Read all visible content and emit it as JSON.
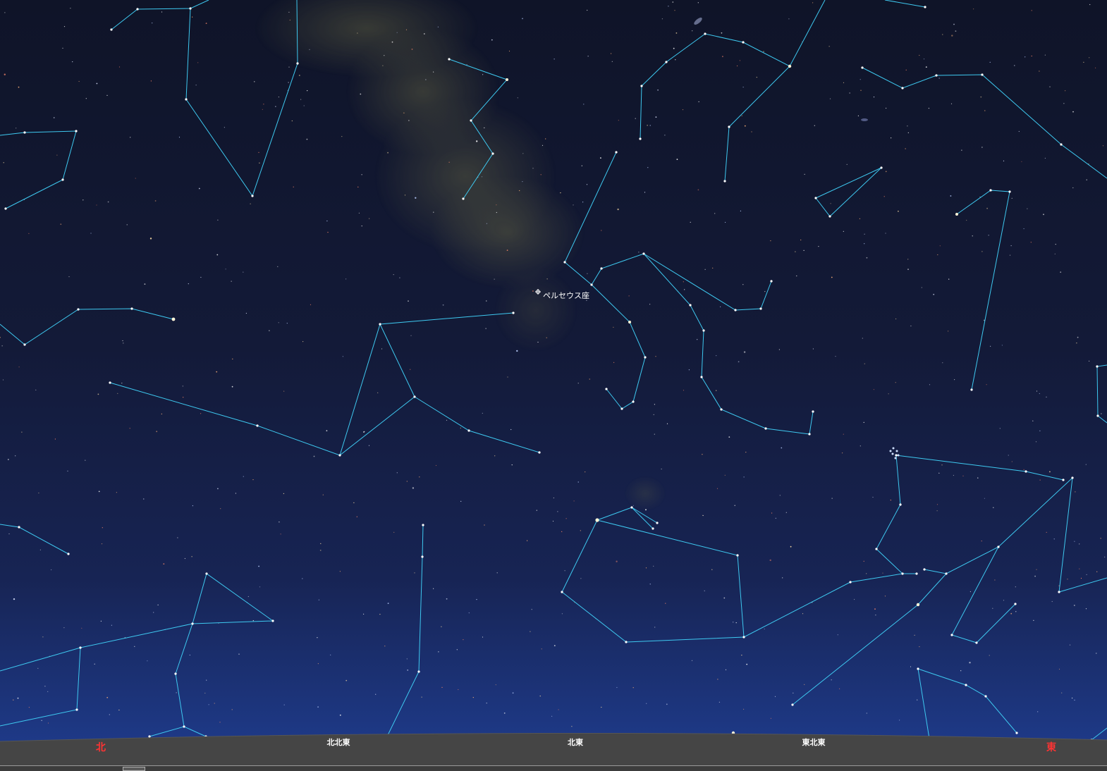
{
  "constellation_label": "ペルセウス座",
  "horizon": {
    "directions": [
      {
        "label": "北",
        "major": true
      },
      {
        "label": "北北東",
        "major": false
      },
      {
        "label": "北東",
        "major": false
      },
      {
        "label": "東北東",
        "major": false
      },
      {
        "label": "東",
        "major": true
      }
    ]
  },
  "colors": {
    "sky_top": "#0f1428",
    "sky_horizon": "#1f3c8c",
    "constellation_line": "#3ec9f0",
    "ground": "#454545",
    "major_direction": "#ff3333"
  }
}
